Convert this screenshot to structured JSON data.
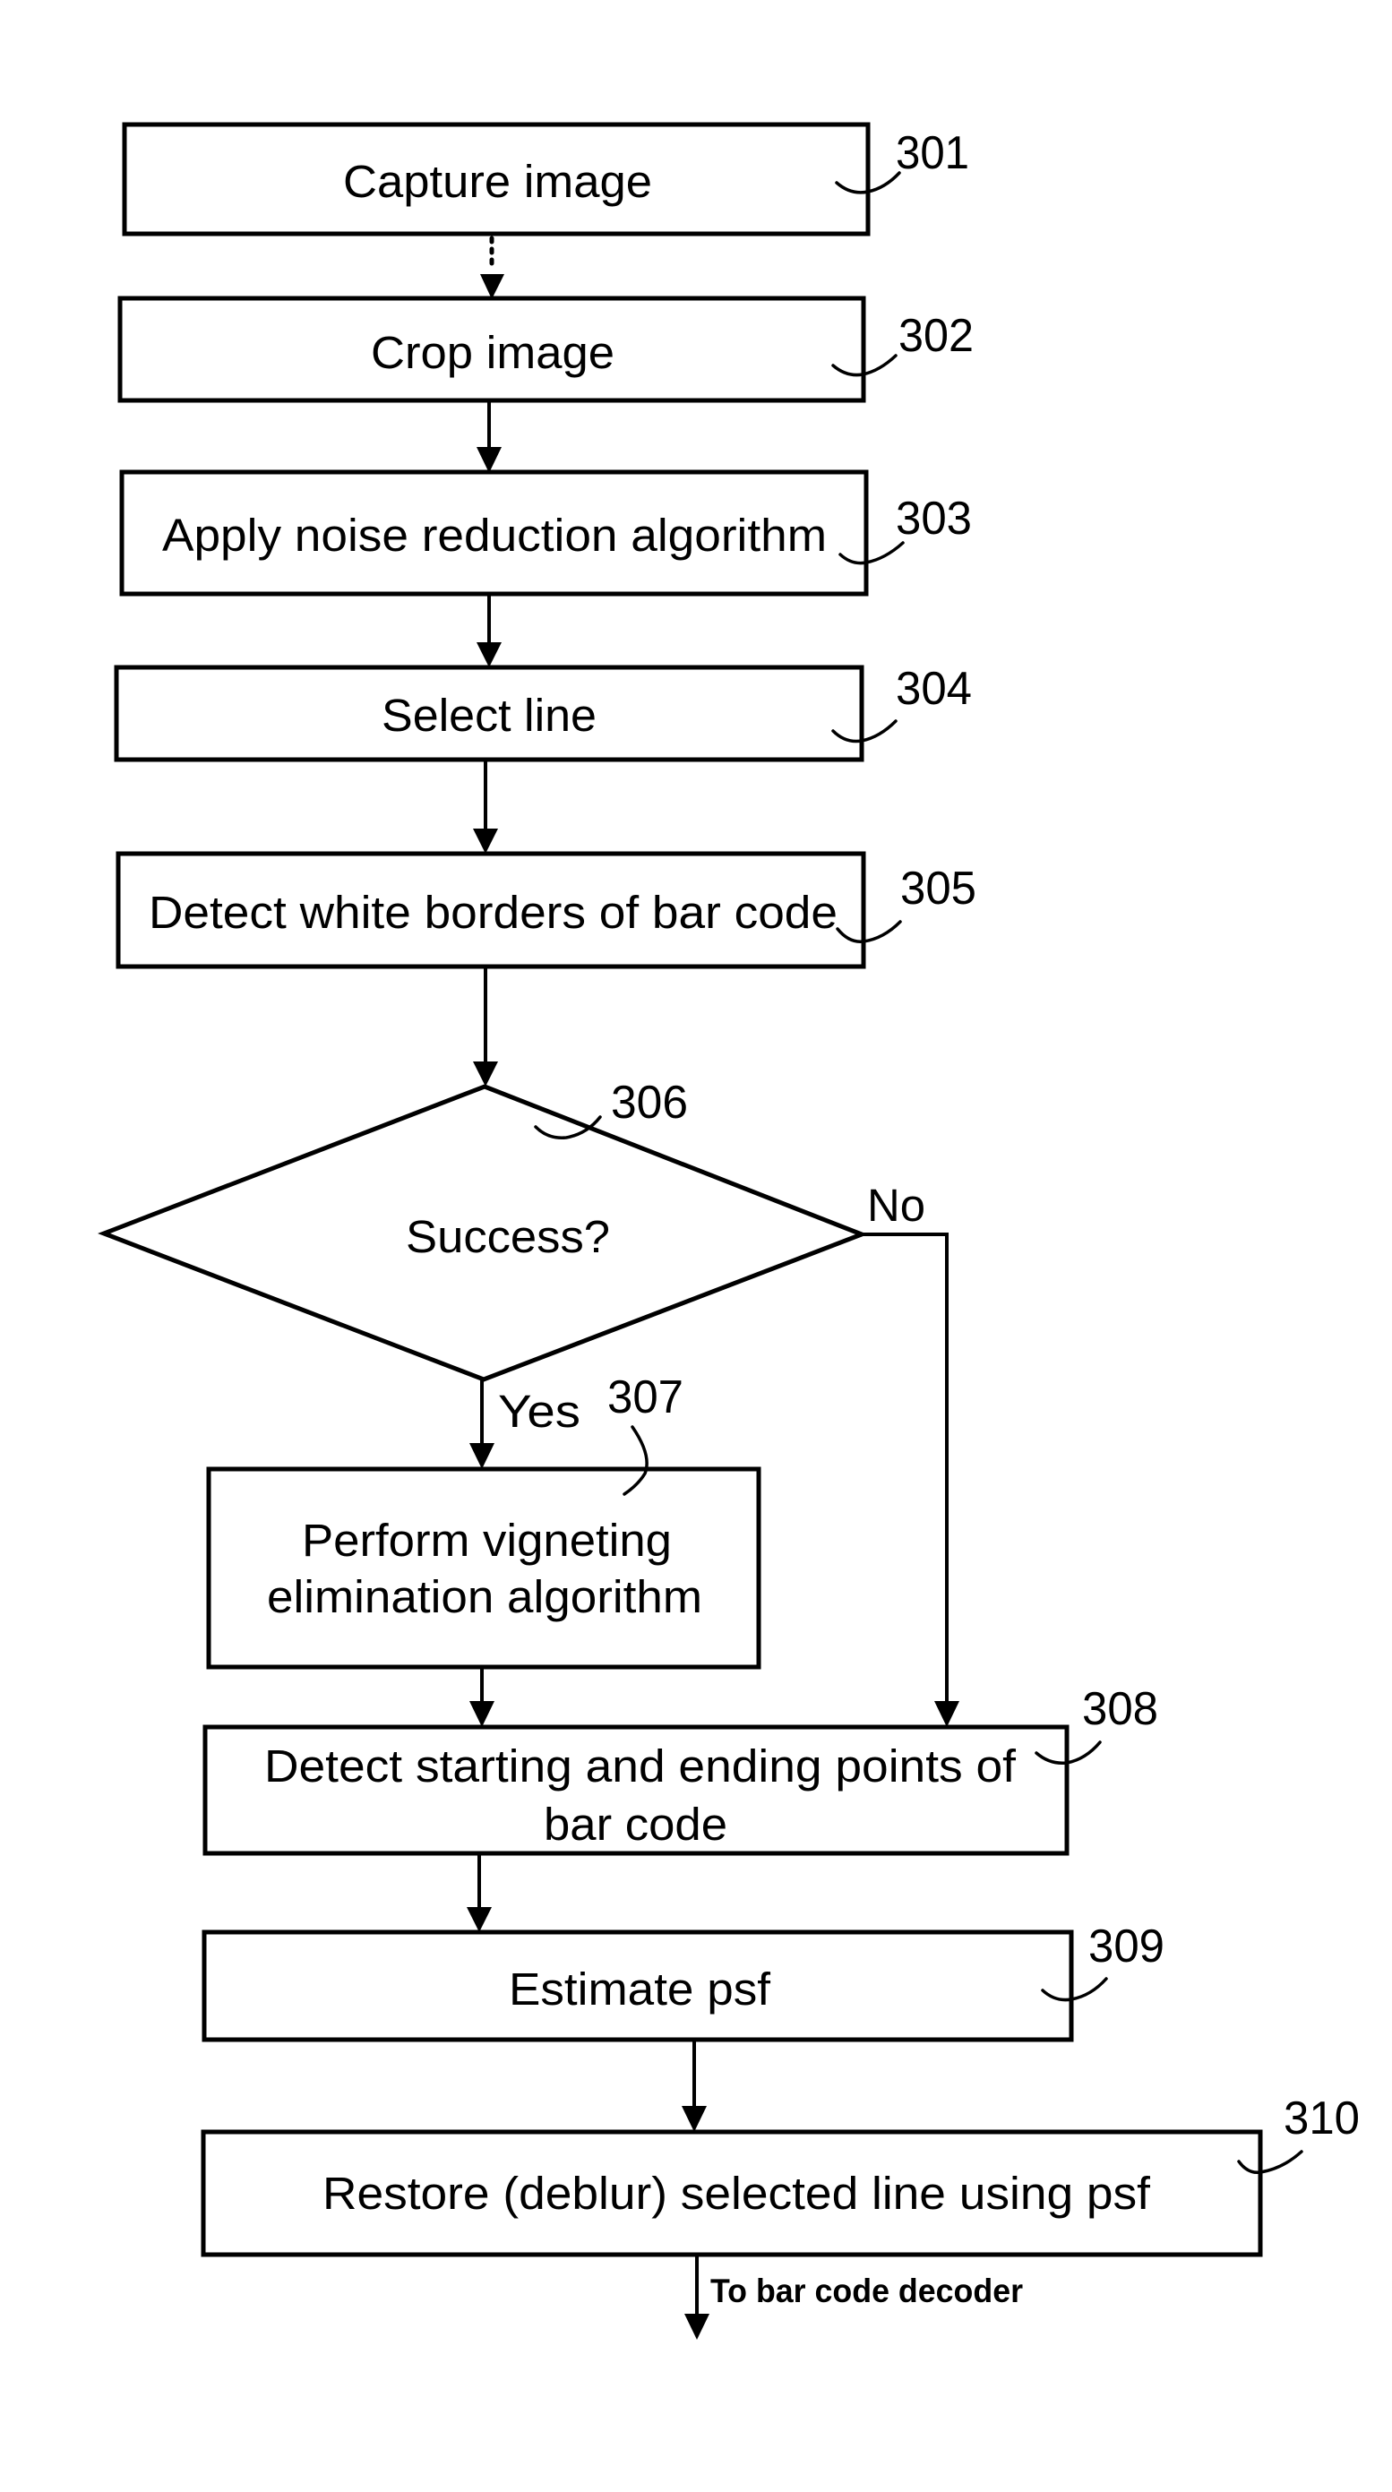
{
  "diagram": {
    "type": "flowchart",
    "steps": [
      {
        "ref": "301",
        "label": "Capture image"
      },
      {
        "ref": "302",
        "label": "Crop image"
      },
      {
        "ref": "303",
        "label": "Apply noise reduction algorithm"
      },
      {
        "ref": "304",
        "label": "Select line"
      },
      {
        "ref": "305",
        "label": "Detect white borders of bar code"
      },
      {
        "ref": "306",
        "label": "Success?",
        "kind": "decision"
      },
      {
        "ref": "307",
        "label_lines": [
          "Perform vigneting",
          "elimination algorithm"
        ]
      },
      {
        "ref": "308",
        "label_lines": [
          "Detect starting and ending points of",
          "bar code"
        ]
      },
      {
        "ref": "309",
        "label": "Estimate psf"
      },
      {
        "ref": "310",
        "label": "Restore (deblur) selected line using psf"
      }
    ],
    "branches": {
      "yes_label": "Yes",
      "no_label": "No"
    },
    "edges": [
      {
        "from": "301",
        "to": "302",
        "style": "dotted"
      },
      {
        "from": "302",
        "to": "303"
      },
      {
        "from": "303",
        "to": "304"
      },
      {
        "from": "304",
        "to": "305"
      },
      {
        "from": "305",
        "to": "306"
      },
      {
        "from": "306",
        "to": "307",
        "label": "Yes"
      },
      {
        "from": "306",
        "to": "308",
        "label": "No"
      },
      {
        "from": "307",
        "to": "308"
      },
      {
        "from": "308",
        "to": "309"
      },
      {
        "from": "309",
        "to": "310"
      },
      {
        "from": "310",
        "to": "exit"
      }
    ],
    "exit_label": "To bar code decoder"
  }
}
